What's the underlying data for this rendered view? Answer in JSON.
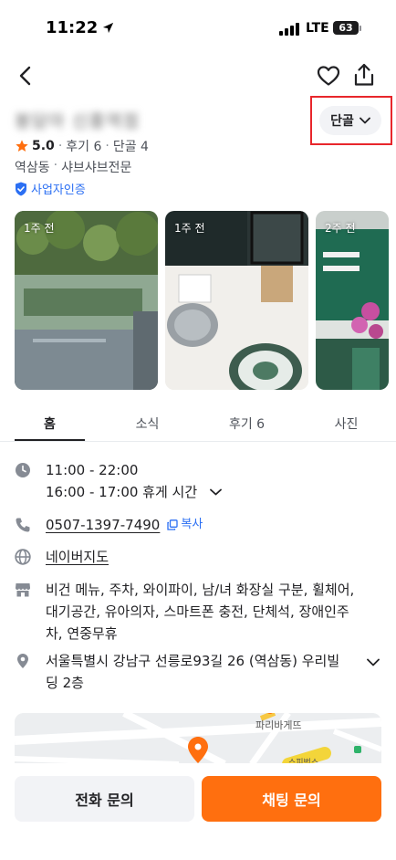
{
  "status_bar": {
    "time": "11:22",
    "network": "LTE",
    "battery": "63"
  },
  "header": {
    "store_name": "봉담아 신흥역점",
    "regular_label": "단골",
    "rating": "5.0",
    "review_count": "후기 6",
    "regular_count": "단골 4",
    "location": "역삼동",
    "category": "샤브샤브전문",
    "verified_label": "사업자인증"
  },
  "photos": [
    {
      "label": "1주 전"
    },
    {
      "label": "1주 전"
    },
    {
      "label": "2주 전"
    }
  ],
  "tabs": [
    {
      "label": "홈"
    },
    {
      "label": "소식"
    },
    {
      "label": "후기 6"
    },
    {
      "label": "사진"
    }
  ],
  "info": {
    "hours": "11:00 - 22:00",
    "break_time": "16:00 - 17:00 휴게 시간",
    "phone": "0507-1397-7490",
    "copy_label": "복사",
    "map_link": "네이버지도",
    "amenities": "비건 메뉴, 주차, 와이파이, 남/녀 화장실 구분, 휠체어, 대기공간, 유아의자, 스마트폰 충전, 단체석, 장애인주차, 연중무휴",
    "address": "서울특별시 강남구 선릉로93길 26 (역삼동) 우리빌딩 2층"
  },
  "map": {
    "place_label_1": "파리바게뜨",
    "place_label_2": "스피벅스"
  },
  "bottom": {
    "call_label": "전화 문의",
    "chat_label": "채팅 문의"
  },
  "colors": {
    "accent": "#ff6f0f",
    "link": "#2b6ff3",
    "highlight": "#e8262b"
  }
}
